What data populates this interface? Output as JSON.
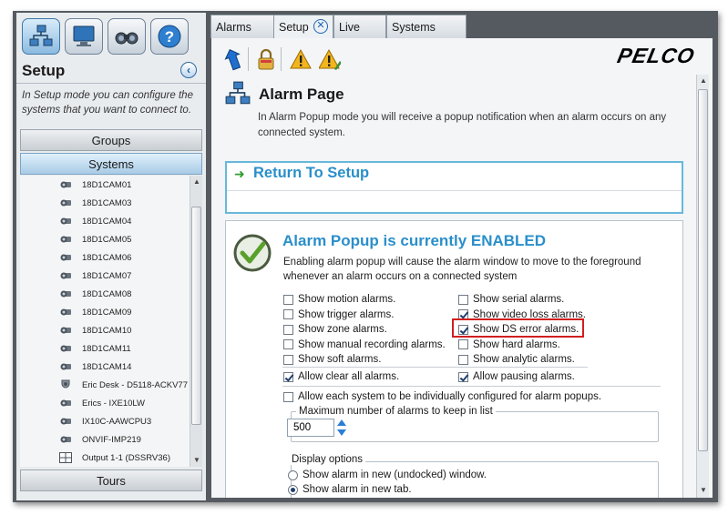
{
  "sidebar": {
    "title": "Setup",
    "description": "In Setup mode you can configure the systems that you want to connect to.",
    "groups_label": "Groups",
    "systems_label": "Systems",
    "tours_label": "Tours",
    "top_buttons": [
      "network-icon",
      "monitor-icon",
      "binoculars-icon",
      "help-icon"
    ],
    "items": [
      {
        "label": "18D1CAM01",
        "icon": "camera-icon"
      },
      {
        "label": "18D1CAM03",
        "icon": "camera-icon"
      },
      {
        "label": "18D1CAM04",
        "icon": "camera-icon"
      },
      {
        "label": "18D1CAM05",
        "icon": "camera-icon"
      },
      {
        "label": "18D1CAM06",
        "icon": "camera-icon"
      },
      {
        "label": "18D1CAM07",
        "icon": "camera-icon"
      },
      {
        "label": "18D1CAM08",
        "icon": "camera-icon"
      },
      {
        "label": "18D1CAM09",
        "icon": "camera-icon"
      },
      {
        "label": "18D1CAM10",
        "icon": "camera-icon"
      },
      {
        "label": "18D1CAM11",
        "icon": "camera-icon"
      },
      {
        "label": "18D1CAM14",
        "icon": "camera-icon"
      },
      {
        "label": "Eric Desk - D5118-ACKV77",
        "icon": "dome-camera-icon"
      },
      {
        "label": "Erics - IXE10LW",
        "icon": "camera-icon"
      },
      {
        "label": "IX10C-AAWCPU3",
        "icon": "camera-icon"
      },
      {
        "label": "ONVIF-IMP219",
        "icon": "camera-icon"
      },
      {
        "label": "Output 1-1 (DSSRV36)",
        "icon": "grid-icon"
      }
    ]
  },
  "tabs": [
    {
      "label": "Alarms"
    },
    {
      "label": "Setup",
      "active": true
    },
    {
      "label": "Live"
    },
    {
      "label": "Systems"
    }
  ],
  "brand": "PELCO",
  "toolbar": [
    "back-arrow-icon",
    "lock-icon",
    "warning-icon",
    "warning-edit-icon"
  ],
  "page": {
    "title": "Alarm Page",
    "description": "In Alarm Popup mode you will receive a popup notification when an alarm occurs on any connected system."
  },
  "return_to_setup": "Return To Setup",
  "alarm_popup": {
    "title": "Alarm Popup is currently ENABLED",
    "description": "Enabling alarm popup will cause the alarm window to move to the foreground whenever an alarm occurs on a connected system",
    "left_options": [
      {
        "label": "Show motion alarms.",
        "checked": false
      },
      {
        "label": "Show trigger alarms.",
        "checked": false
      },
      {
        "label": "Show zone alarms.",
        "checked": false
      },
      {
        "label": "Show manual recording alarms.",
        "checked": false
      },
      {
        "label": "Show soft alarms.",
        "checked": false
      }
    ],
    "right_options": [
      {
        "label": "Show serial alarms.",
        "checked": false
      },
      {
        "label": "Show video loss alarms.",
        "checked": true
      },
      {
        "label": "Show DS error alarms.",
        "checked": true
      },
      {
        "label": "Show hard alarms.",
        "checked": false
      },
      {
        "label": "Show analytic alarms.",
        "checked": false
      }
    ],
    "allow_clear": {
      "label": "Allow clear all alarms.",
      "checked": true
    },
    "allow_pausing": {
      "label": "Allow pausing alarms.",
      "checked": true
    },
    "allow_individual": {
      "label": "Allow each system to be individually configured for alarm popups.",
      "checked": false
    },
    "max_alarms_label": "Maximum number of alarms to keep in list",
    "max_alarms_value": "500",
    "display_options_label": "Display options",
    "display_options": [
      {
        "label": "Show alarm in new (undocked) window.",
        "selected": false
      },
      {
        "label": "Show alarm in new tab.",
        "selected": true
      }
    ]
  },
  "colors": {
    "accent_blue": "#2a8fca",
    "highlight_red": "#d11f1f",
    "frame_gray": "#555a60"
  }
}
